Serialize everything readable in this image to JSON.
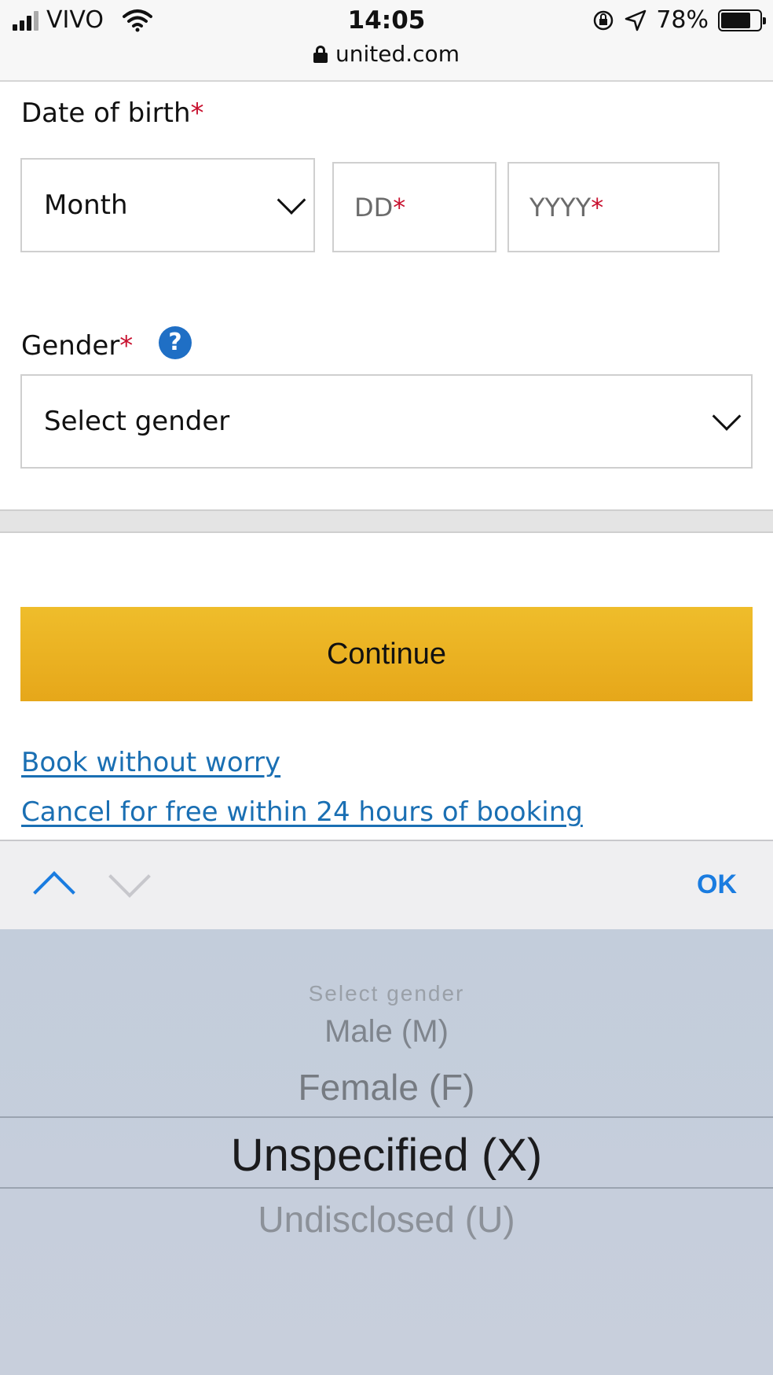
{
  "status": {
    "carrier": "VIVO",
    "time": "14:05",
    "battery": "78%",
    "battery_level": 0.78,
    "url": "united.com",
    "icons": [
      "signal-icon",
      "wifi-icon",
      "orientation-lock-icon",
      "location-icon",
      "battery-icon",
      "lock-icon"
    ]
  },
  "form": {
    "dob_label": "Date of birth",
    "required_mark": "*",
    "month": {
      "value": "Month"
    },
    "day": {
      "placeholder": "DD"
    },
    "year": {
      "placeholder": "YYYY"
    },
    "gender_label": "Gender",
    "help_symbol": "?",
    "gender_select": {
      "value": "Select gender"
    }
  },
  "actions": {
    "continue_label": "Continue"
  },
  "links": [
    {
      "label": "Book without worry"
    },
    {
      "label": "Cancel for free within 24 hours of booking"
    }
  ],
  "keyboard": {
    "ok_label": "OK"
  },
  "picker": {
    "options": [
      "Select gender",
      "Male (M)",
      "Female (F)",
      "Unspecified (X)",
      "Undisclosed (U)"
    ],
    "selected": "Unspecified (X)"
  },
  "colors": {
    "required": "#c8102e",
    "link": "#1a6fb3",
    "continue_button": "#efbd2b",
    "ios_blue": "#1a7ce0",
    "help_badge": "#1f6fc5"
  }
}
